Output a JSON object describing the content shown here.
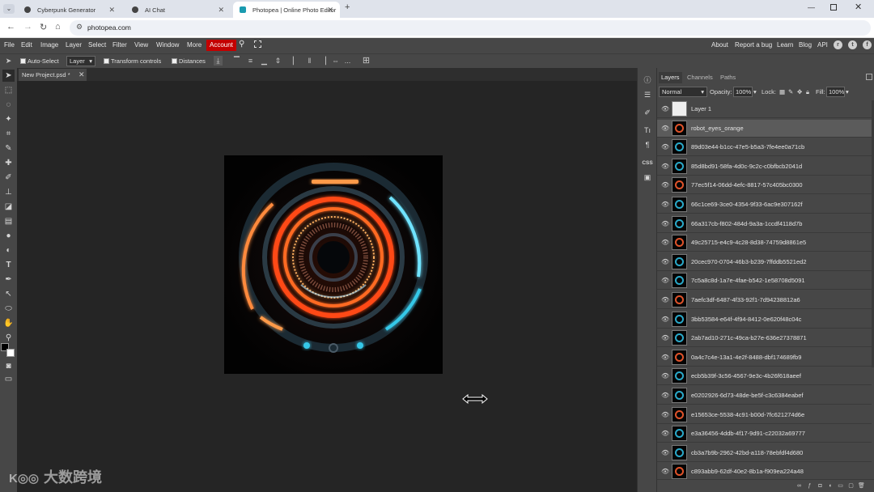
{
  "browser": {
    "tabs": [
      {
        "title": "Cyberpunk Generator",
        "active": false
      },
      {
        "title": "AI Chat",
        "active": false
      },
      {
        "title": "Photopea | Online Photo Editor",
        "active": true
      }
    ],
    "url": "photopea.com"
  },
  "menubar": {
    "items": [
      "File",
      "Edit",
      "Image",
      "Layer",
      "Select",
      "Filter",
      "View",
      "Window",
      "More"
    ],
    "account": "Account",
    "right_links": [
      "About",
      "Report a bug",
      "Learn",
      "Blog",
      "API"
    ]
  },
  "options": {
    "auto_select": "Auto-Select",
    "layer_mode": "Layer",
    "transform_controls": "Transform controls",
    "distances": "Distances",
    "more": "..."
  },
  "document": {
    "tab_title": "New Project.psd *"
  },
  "minipanel": {
    "css_label": "CSS"
  },
  "layers_panel": {
    "tabs": [
      "Layers",
      "Channels",
      "Paths"
    ],
    "blend_mode": "Normal",
    "opacity_label": "Opacity:",
    "opacity": "100%",
    "lock_label": "Lock:",
    "fill_label": "Fill:",
    "fill": "100%",
    "layers": [
      {
        "name": "Layer 1",
        "selected": false
      },
      {
        "name": "robot_eyes_orange",
        "selected": true
      },
      {
        "name": "89d03e44-b1cc-47e5-b5a3-7fe4ee0a71cb",
        "selected": false
      },
      {
        "name": "85d8bd91-58fa-4d0c-9c2c-c0bfbcb2041d",
        "selected": false
      },
      {
        "name": "77ec5f14-06dd-4efc-8817-57c405bc0300",
        "selected": false
      },
      {
        "name": "66c1ce69-3ce0-4354-9f33-6ac9e307162f",
        "selected": false
      },
      {
        "name": "66a317cb-f802-484d-9a3a-1ccdf4118d7b",
        "selected": false
      },
      {
        "name": "49c25715-e4c9-4c28-8d38-74759d8861e5",
        "selected": false
      },
      {
        "name": "20cec970-0704-46b3-b239-7ffddb5521ed2",
        "selected": false
      },
      {
        "name": "7c5a8c8d-1a7e-4fae-b542-1e58708d5091",
        "selected": false
      },
      {
        "name": "7aefc3df-6487-4f33-92f1-7d94238812a6",
        "selected": false
      },
      {
        "name": "3bb53584-e64f-4f94-8412-0e620f48c04c",
        "selected": false
      },
      {
        "name": "2ab7ad10-271c-49ca-b27e-636e27378871",
        "selected": false
      },
      {
        "name": "0a4c7c4e-13a1-4e2f-8488-dbf174689fb9",
        "selected": false
      },
      {
        "name": "ecb5b39f-3c56-4567-9e3c-4b26f618aeef",
        "selected": false
      },
      {
        "name": "e0202926-6d73-48de-be5f-c3c6384eabef",
        "selected": false
      },
      {
        "name": "e15653ce-5538-4c91-b00d-7fc621274d6e",
        "selected": false
      },
      {
        "name": "e3a36456-4ddb-4f17-9d91-c22032a69777",
        "selected": false
      },
      {
        "name": "cb3a7b9b-2962-42bd-a118-78ebfdf4d680",
        "selected": false
      },
      {
        "name": "c893abb9-62df-40e2-8b1a-f909ea224a48",
        "selected": false
      }
    ]
  },
  "watermark": "大数跨境",
  "colors": {
    "accent_account": "#c30000",
    "panel_bg": "#474747",
    "workspace_bg": "#252525",
    "glow_orange": "#ff5a1e",
    "glow_cyan": "#35c8e8"
  }
}
